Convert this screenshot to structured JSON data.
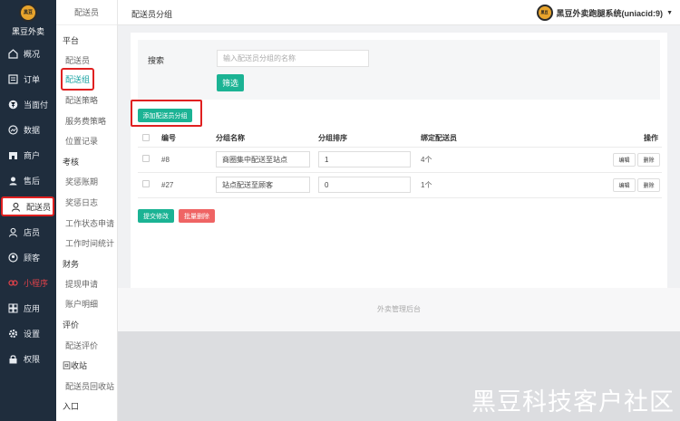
{
  "brand": {
    "name": "黑豆外卖",
    "logo_text": "黑豆"
  },
  "sidebar": {
    "items": [
      {
        "label": "概况",
        "icon": "home-icon"
      },
      {
        "label": "订单",
        "icon": "list-icon"
      },
      {
        "label": "当面付",
        "icon": "yen-icon"
      },
      {
        "label": "数据",
        "icon": "chart-icon"
      },
      {
        "label": "商户",
        "icon": "shop-icon"
      },
      {
        "label": "售后",
        "icon": "service-icon"
      },
      {
        "label": "配送员",
        "icon": "user-icon"
      },
      {
        "label": "店员",
        "icon": "staff-icon"
      },
      {
        "label": "顾客",
        "icon": "customer-icon"
      },
      {
        "label": "小程序",
        "icon": "miniapp-icon"
      },
      {
        "label": "应用",
        "icon": "apps-icon"
      },
      {
        "label": "设置",
        "icon": "gear-icon"
      },
      {
        "label": "权限",
        "icon": "lock-icon"
      }
    ]
  },
  "subnav": {
    "title": "配送员",
    "sections": [
      {
        "label": "平台",
        "links": [
          "配送员",
          "配送组",
          "配送策略",
          "服务费策略",
          "位置记录"
        ]
      },
      {
        "label": "考核",
        "links": [
          "奖惩账期",
          "奖惩日志",
          "工作状态申请",
          "工作时间统计"
        ]
      },
      {
        "label": "财务",
        "links": [
          "提现申请",
          "账户明细"
        ]
      },
      {
        "label": "评价",
        "links": [
          "配送评价"
        ]
      },
      {
        "label": "回收站",
        "links": [
          "配送员回收站"
        ]
      },
      {
        "label": "入口",
        "links": []
      }
    ]
  },
  "topbar": {
    "title": "配送员分组",
    "system_name": "黑豆外卖跑腿系统(uniacid:9)"
  },
  "search": {
    "label": "搜索",
    "placeholder": "输入配送员分组的名称",
    "button": "筛选"
  },
  "actions": {
    "add": "添加配送员分组",
    "submit": "提交修改",
    "batch_delete": "批量删除"
  },
  "table": {
    "headers": [
      "编号",
      "分组名称",
      "分组排序",
      "绑定配送员",
      "操作"
    ],
    "rows": [
      {
        "id": "#8",
        "name": "商圈集中配送至站点",
        "sort": "1",
        "riders": "4个",
        "edit": "编辑",
        "delete": "删除"
      },
      {
        "id": "#27",
        "name": "站点配送至顾客",
        "sort": "0",
        "riders": "1个",
        "edit": "编辑",
        "delete": "删除"
      }
    ]
  },
  "footer": {
    "text": "外卖管理后台"
  },
  "watermark": "黑豆科技客户社区"
}
